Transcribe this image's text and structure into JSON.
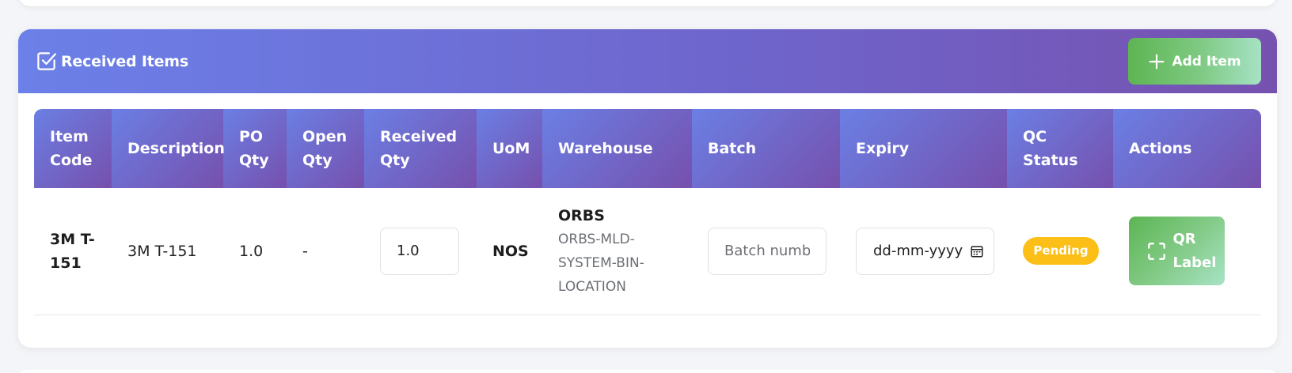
{
  "header": {
    "title": "Received Items",
    "add_button_label": "Add Item"
  },
  "table": {
    "columns": {
      "item_code": "Item Code",
      "description": "Description",
      "po_qty": "PO Qty",
      "open_qty": "Open Qty",
      "received_qty": "Received Qty",
      "uom": "UoM",
      "warehouse": "Warehouse",
      "batch": "Batch",
      "expiry": "Expiry",
      "qc_status": "QC Status",
      "actions": "Actions"
    },
    "rows": [
      {
        "item_code": "3M T-151",
        "description": "3M T-151",
        "po_qty": "1.0",
        "open_qty": "-",
        "received_qty": "1.0",
        "uom": "NOS",
        "warehouse_name": "ORBS",
        "warehouse_location": "ORBS-MLD-SYSTEM-BIN-LOCATION",
        "batch_placeholder": "Batch number",
        "expiry_placeholder": "dd-mm-yyyy",
        "qc_status": "Pending",
        "action_label": "QR Label"
      }
    ]
  },
  "colors": {
    "header_gradient_start": "#6b80e8",
    "header_gradient_end": "#7652b0",
    "success_green": "#5eb552",
    "pending_badge": "#fbbf17"
  },
  "icons": {
    "title_icon": "checkbox-icon",
    "add_icon": "plus-icon",
    "calendar_icon": "calendar-icon",
    "qr_icon": "scan-frame-icon"
  }
}
